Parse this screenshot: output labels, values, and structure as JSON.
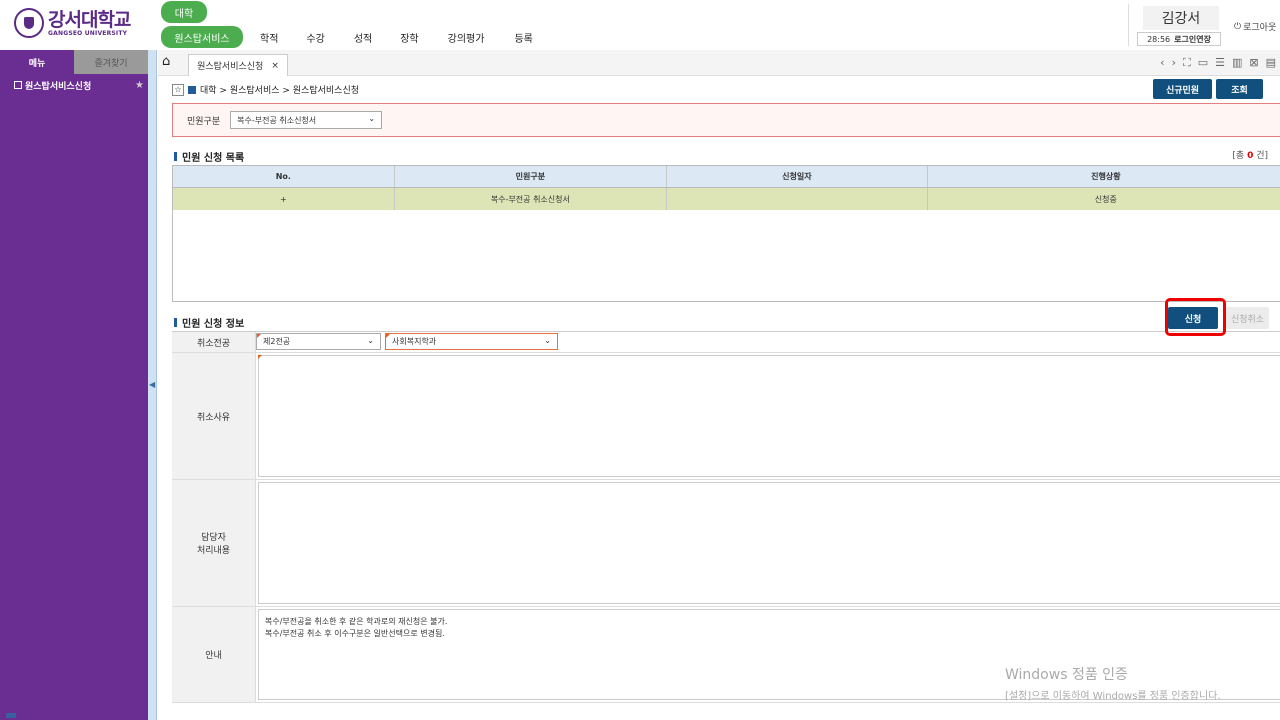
{
  "header": {
    "logo_ko": "강서대학교",
    "logo_en": "GANGSEO UNIVERSITY",
    "top_tag": "대학",
    "nav": [
      "원스탑서비스",
      "학적",
      "수강",
      "성적",
      "장학",
      "강의평가",
      "등록"
    ],
    "user_name": "김강서",
    "session_time": "28:56",
    "session_extend": "로그인연장",
    "logout": "로그아웃"
  },
  "sidebar": {
    "tabs": [
      "메뉴",
      "즐겨찾기"
    ],
    "items": [
      {
        "label": "원스탑서비스신청"
      }
    ]
  },
  "tabbar": {
    "tab_label": "원스탑서비스신청"
  },
  "breadcrumb": "대학 > 원스탑서비스 > 원스탑서비스신청",
  "buttons": {
    "new": "신규민원",
    "search": "조회",
    "apply": "신청",
    "cancel_apply": "신청취소"
  },
  "filter": {
    "label": "민원구분",
    "value": "복수-부전공 취소신청서"
  },
  "list_section": {
    "title": "민원 신청 목록",
    "count_prefix": "[총 ",
    "count": "0",
    "count_suffix": " 건]",
    "columns": [
      "No.",
      "민원구분",
      "신청일자",
      "진행상황"
    ],
    "rows": [
      {
        "no": "+",
        "type": "복수-부전공 취소신청서",
        "date": "",
        "status": "신청중"
      }
    ]
  },
  "info_section": {
    "title": "민원 신청 정보",
    "cancel_major_label": "취소전공",
    "cancel_major_value": "제2전공",
    "department_value": "사회복지학과",
    "reason_label": "취소사유",
    "handler_label_1": "담당자",
    "handler_label_2": "처리내용",
    "notice_label": "안내",
    "notice_lines": [
      "복수/부전공을 취소한 후 같은 학과로의 재신청은 불가.",
      "복수/부전공 취소 후 이수구분은 일반선택으로 변경됨."
    ]
  },
  "watermark": {
    "line1": "Windows 정품 인증",
    "line2": "[설정]으로 이동하여 Windows를 정품 인증합니다."
  }
}
